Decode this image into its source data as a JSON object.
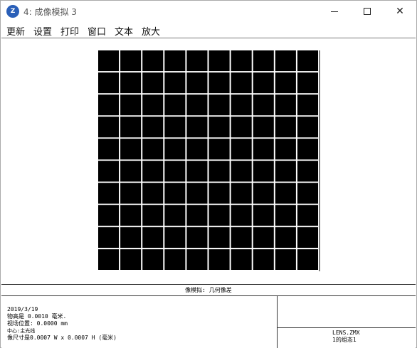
{
  "window": {
    "icon_label": "Z",
    "title": "4: 成像模拟 3",
    "controls": {
      "minimize_icon": "minimize-icon",
      "maximize_icon": "maximize-icon",
      "close_icon": "close-icon",
      "close_glyph": "✕"
    }
  },
  "menu": [
    "更新",
    "设置",
    "打印",
    "窗口",
    "文本",
    "放大"
  ],
  "image": {
    "type": "grid-pattern",
    "rows": 10,
    "cols": 10,
    "cell_color": "#000000",
    "line_color": "#ffffff"
  },
  "footer": {
    "caption": "像模拟: 几何像差",
    "date": "2019/3/19",
    "object_height": "物高是 0.0010 毫米.",
    "field_position": "视场位置: 0.0000 mm",
    "center": "中心:主光线",
    "pixel_size": "像尺寸是0.0007 W x 0.0007 H (毫米)",
    "lens_file": "LENS.ZMX",
    "config": "1的组态1"
  }
}
